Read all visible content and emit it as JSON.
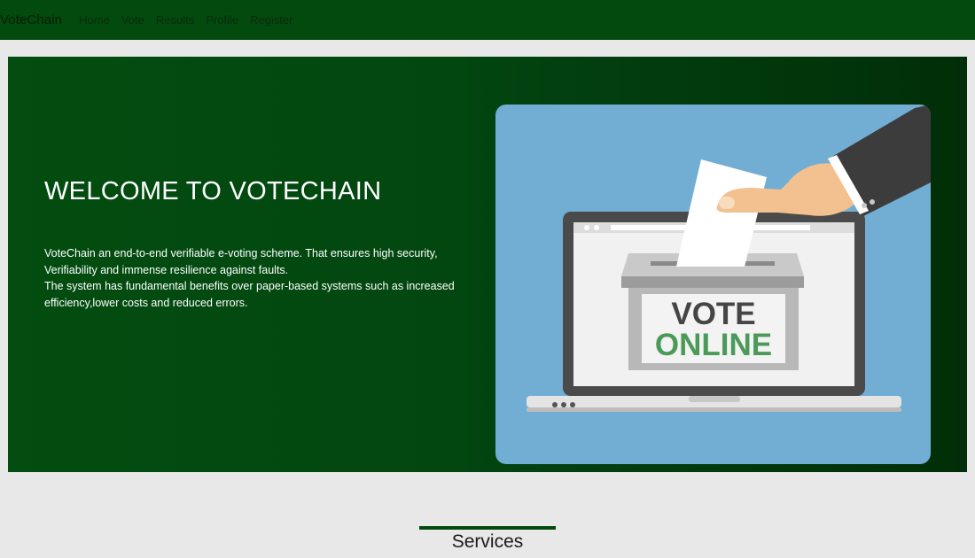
{
  "navbar": {
    "brand": "VoteChain",
    "links": [
      "Home",
      "Vote",
      "Results",
      "Profile",
      "Register"
    ]
  },
  "hero": {
    "title": "WELCOME TO VOTECHAIN",
    "paragraphs": [
      "VoteChain an end-to-end verifiable e-voting scheme. That ensures high security,",
      "Verifiability and immense resilience against faults.",
      "The system has fundamental benefits over paper-based systems such as increased",
      "efficiency,lower costs and reduced errors."
    ],
    "image": {
      "line1": "VOTE",
      "line2": "ONLINE"
    }
  },
  "services": {
    "title": "Services"
  },
  "colors": {
    "navbar": "#024a0d",
    "hero_bg": "#034d10",
    "image_bg": "#72aed4",
    "vote_dark": "#454545",
    "vote_green": "#4c9a5a"
  }
}
